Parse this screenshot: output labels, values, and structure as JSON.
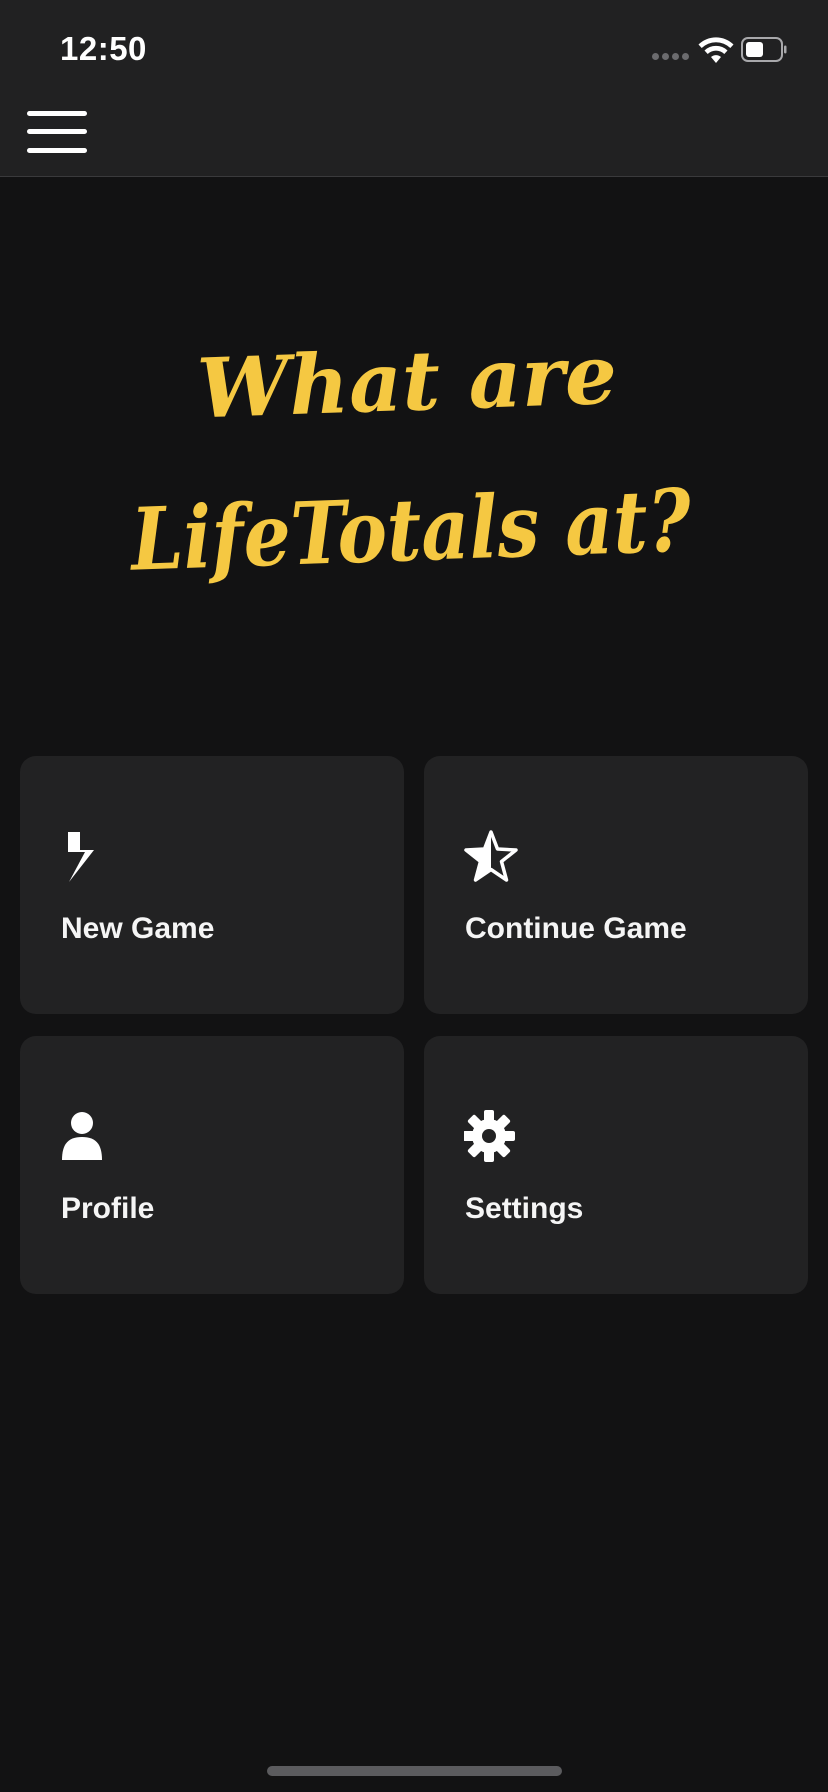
{
  "status_bar": {
    "time": "12:50"
  },
  "nav": {
    "menu_icon": "hamburger-menu-icon"
  },
  "title": {
    "line1": "What are",
    "line2": "LifeTotals at?",
    "color": "#f5c842"
  },
  "tiles": [
    {
      "label": "New Game",
      "icon": "lightning-bolt-icon"
    },
    {
      "label": "Continue Game",
      "icon": "star-half-icon"
    },
    {
      "label": "Profile",
      "icon": "user-icon"
    },
    {
      "label": "Settings",
      "icon": "gear-icon"
    }
  ],
  "colors": {
    "background": "#121213",
    "topbar": "#212122",
    "tile": "#222223",
    "accent": "#f5c842",
    "text": "#f5f5f5"
  }
}
